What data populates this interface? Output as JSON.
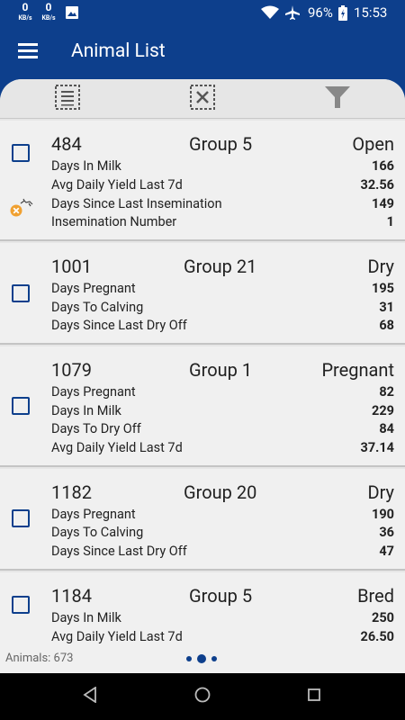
{
  "status_bar": {
    "net1_speed": "0",
    "net1_unit": "KB/s",
    "net2_speed": "0",
    "net2_unit": "KB/s",
    "battery": "96%",
    "time": "15:53"
  },
  "app_bar": {
    "title": "Animal List"
  },
  "toolbar": {
    "select_all_icon": "select-all-icon",
    "deselect_icon": "deselect-icon",
    "filter_icon": "filter-icon"
  },
  "animals": [
    {
      "id": "484",
      "group": "Group 5",
      "status": "Open",
      "alert": true,
      "metrics": [
        {
          "label": "Days In Milk",
          "value": "166"
        },
        {
          "label": "Avg Daily Yield Last 7d",
          "value": "32.56"
        },
        {
          "label": "Days Since Last Insemination",
          "value": "149"
        },
        {
          "label": "Insemination Number",
          "value": "1"
        }
      ]
    },
    {
      "id": "1001",
      "group": "Group 21",
      "status": "Dry",
      "alert": false,
      "metrics": [
        {
          "label": "Days Pregnant",
          "value": "195"
        },
        {
          "label": "Days To Calving",
          "value": "31"
        },
        {
          "label": "Days Since Last Dry Off",
          "value": "68"
        }
      ]
    },
    {
      "id": "1079",
      "group": "Group 1",
      "status": "Pregnant",
      "alert": false,
      "metrics": [
        {
          "label": "Days Pregnant",
          "value": "82"
        },
        {
          "label": "Days In Milk",
          "value": "229"
        },
        {
          "label": "Days To Dry Off",
          "value": "84"
        },
        {
          "label": "Avg Daily Yield Last 7d",
          "value": "37.14"
        }
      ]
    },
    {
      "id": "1182",
      "group": "Group 20",
      "status": "Dry",
      "alert": false,
      "metrics": [
        {
          "label": "Days Pregnant",
          "value": "190"
        },
        {
          "label": "Days To Calving",
          "value": "36"
        },
        {
          "label": "Days Since Last Dry Off",
          "value": "47"
        }
      ]
    },
    {
      "id": "1184",
      "group": "Group 5",
      "status": "Bred",
      "alert": false,
      "metrics": [
        {
          "label": "Days In Milk",
          "value": "250"
        },
        {
          "label": "Avg Daily Yield Last 7d",
          "value": "26.50"
        }
      ]
    }
  ],
  "footer": {
    "animals_count": "Animals: 673"
  },
  "page_indicator": {
    "pages": 3,
    "current": 2
  },
  "colors": {
    "primary": "#0d3f8c",
    "alert": "#f0a030"
  }
}
